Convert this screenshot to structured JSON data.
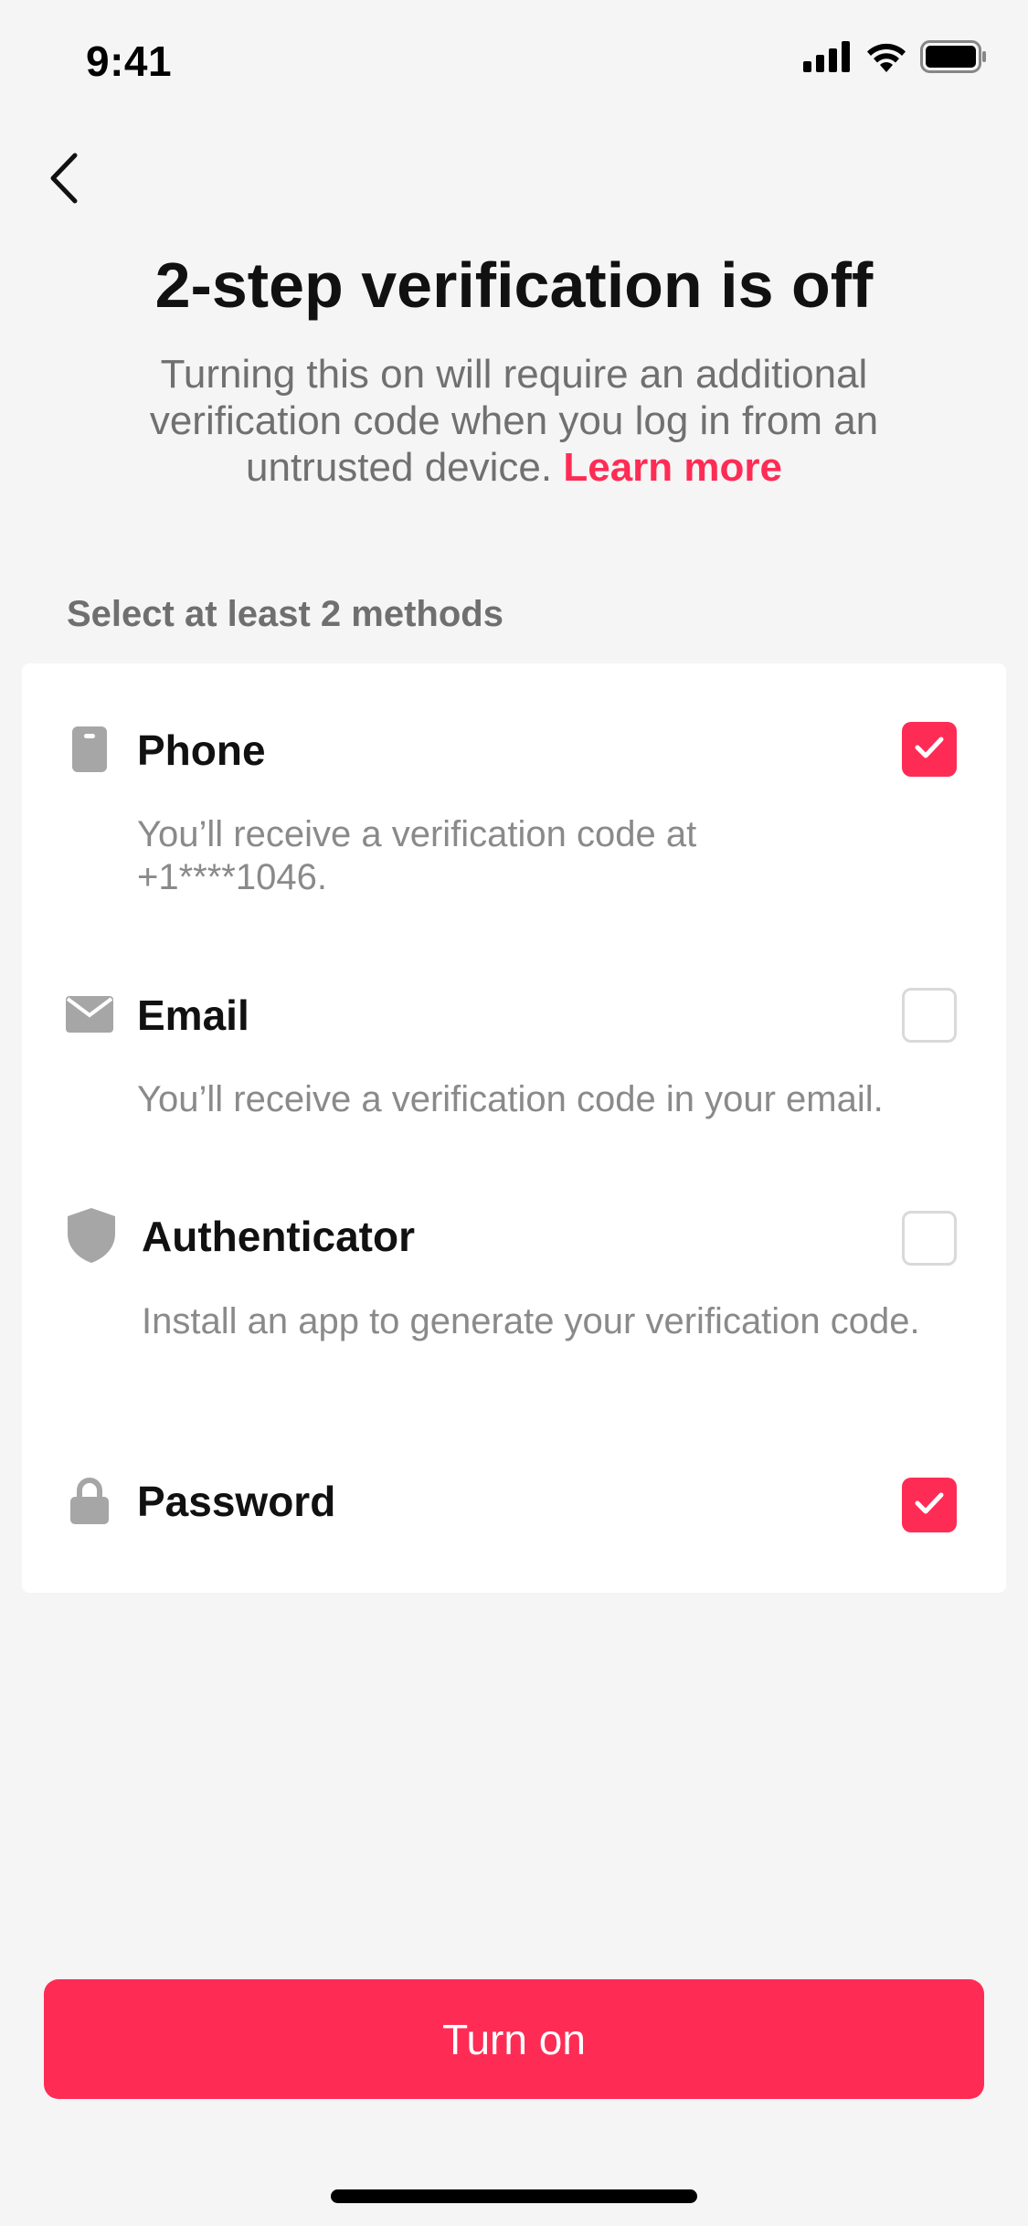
{
  "status_bar": {
    "time": "9:41"
  },
  "nav": {
    "back_icon": "chevron-left-icon"
  },
  "header": {
    "title": "2-step verification is off",
    "subtitle": "Turning this on will require an additional verification code when you log in from an untrusted device.",
    "learn_more": "Learn more"
  },
  "section": {
    "label": "Select at least 2 methods"
  },
  "methods": [
    {
      "id": "phone",
      "title": "Phone",
      "description": "You’ll receive a verification code at +1****1046.",
      "icon": "phone-icon",
      "checked": true
    },
    {
      "id": "email",
      "title": "Email",
      "description": "You’ll receive a verification code in your email.",
      "icon": "envelope-icon",
      "checked": false
    },
    {
      "id": "authenticator",
      "title": "Authenticator",
      "description": "Install an app to generate your verification code.",
      "icon": "shield-icon",
      "checked": false
    },
    {
      "id": "password",
      "title": "Password",
      "description": "",
      "icon": "lock-icon",
      "checked": true
    }
  ],
  "footer": {
    "turn_on_label": "Turn on"
  },
  "colors": {
    "accent": "#fe2c55",
    "background": "#f5f5f5",
    "card": "#ffffff",
    "icon_gray": "#a6a6a6"
  }
}
